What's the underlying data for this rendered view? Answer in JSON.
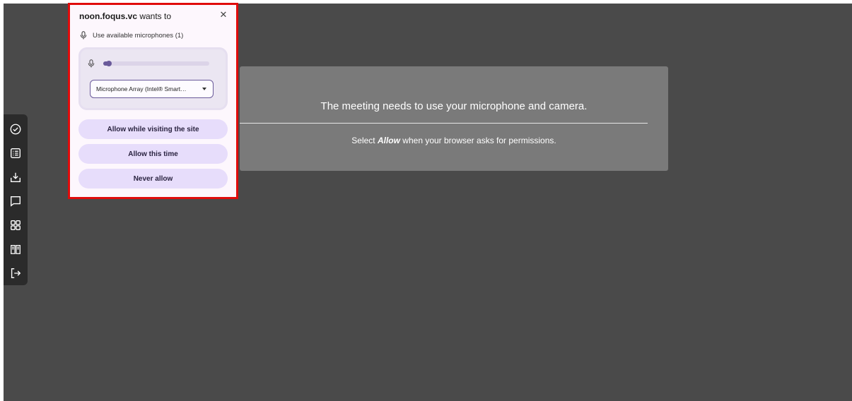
{
  "popup": {
    "site": "noon.foqus.vc",
    "wants_to": " wants to",
    "close_glyph": "✕",
    "permission_label": "Use available microphones (1)",
    "mic_level_fraction": 0.05,
    "selected_microphone": "Microphone Array (Intel® Smart…",
    "buttons": {
      "allow_visit": "Allow while visiting the site",
      "allow_once": "Allow this time",
      "never": "Never allow"
    },
    "highlight_color": "#e00b0b"
  },
  "notice": {
    "title": "The meeting needs to use your microphone and camera.",
    "sub_prefix": "Select ",
    "sub_emphasis": "Allow",
    "sub_suffix": " when your browser asks for permissions."
  },
  "toolbar": {
    "items": [
      "check-circle-icon",
      "list-icon",
      "download-icon",
      "chat-icon",
      "grid-icon",
      "book-icon",
      "exit-icon"
    ]
  },
  "colors": {
    "stage_bg": "#4a4a4a",
    "notice_bg": "#7a7a7a",
    "button_bg": "#e7ddfb",
    "accent": "#6a5a9a"
  }
}
